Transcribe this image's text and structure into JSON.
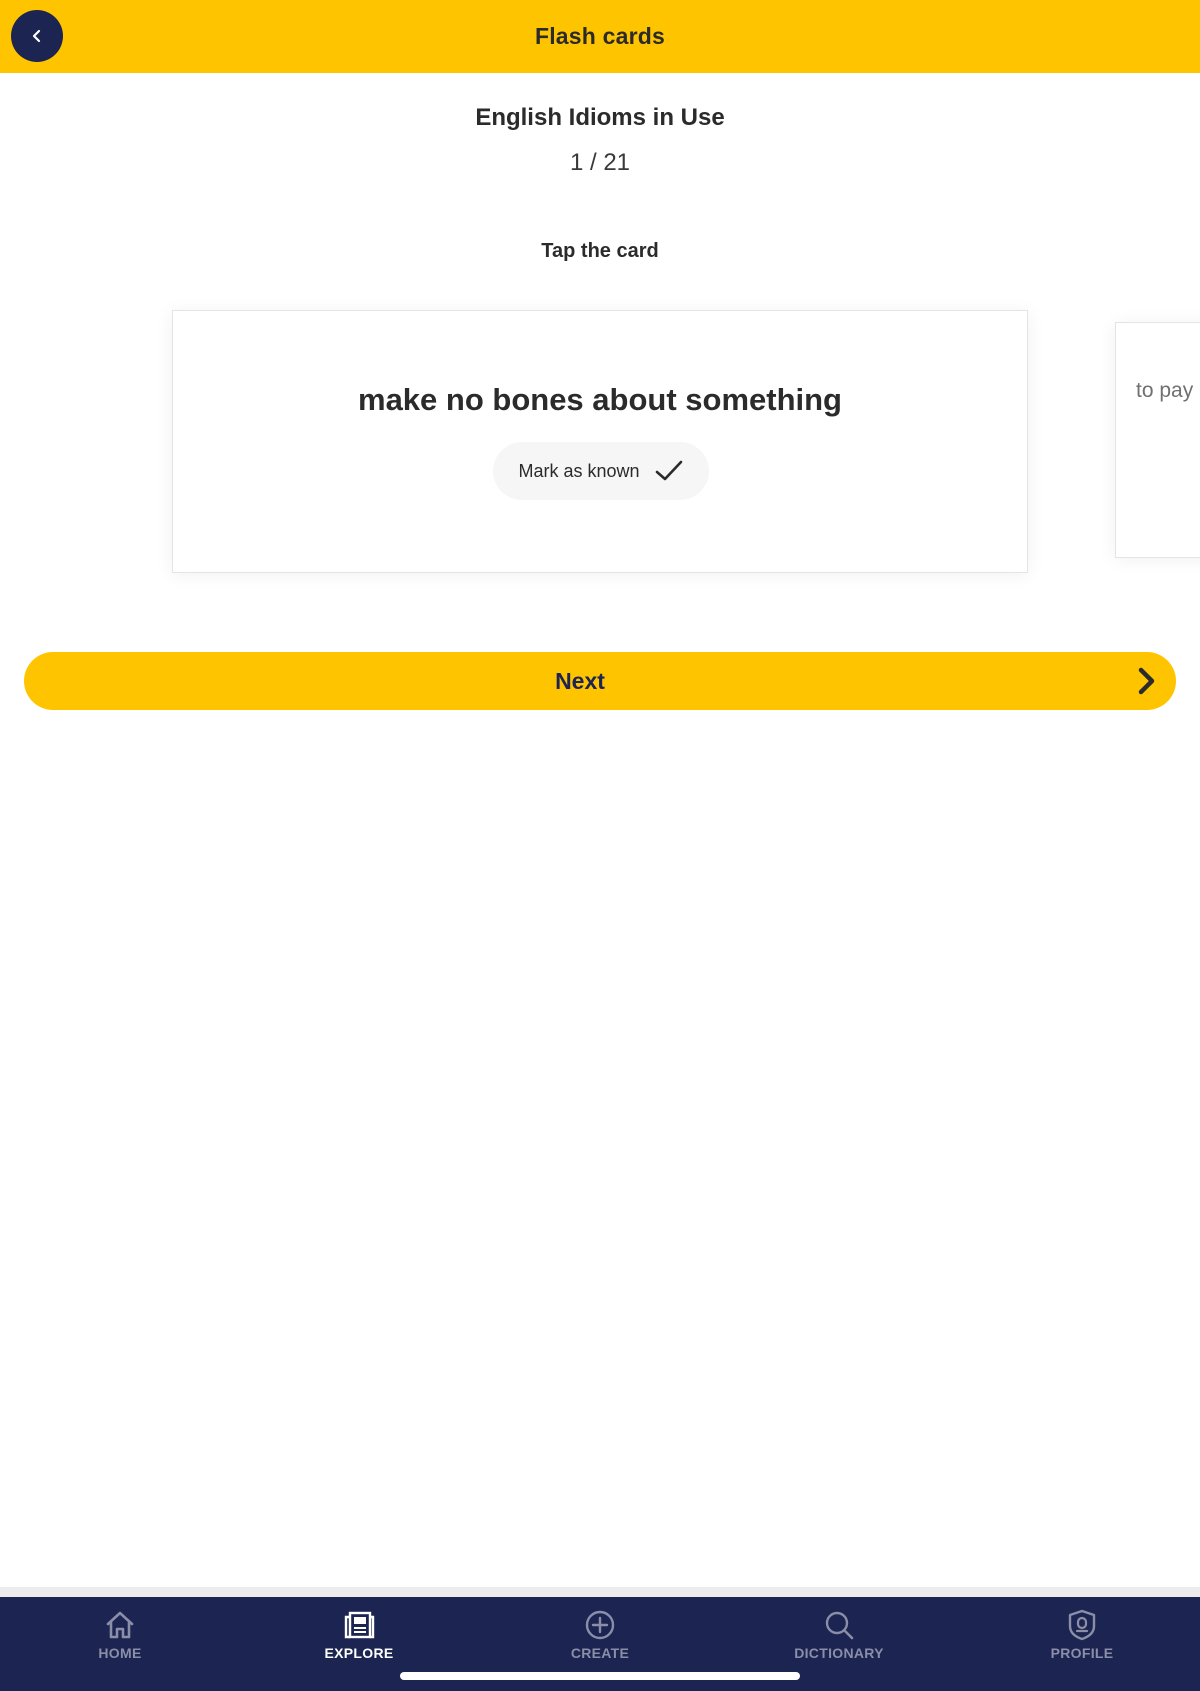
{
  "header": {
    "title": "Flash cards",
    "back_icon": "chevron-left-icon"
  },
  "deck": {
    "title": "English Idioms in Use",
    "progress": "1 / 21"
  },
  "instruction": "Tap the card",
  "card": {
    "term": "make no bones about something",
    "mark_known_label": "Mark as known",
    "mark_known_icon": "check-icon"
  },
  "next_card_peek": {
    "text": "to pay"
  },
  "next_button": {
    "label": "Next",
    "icon": "chevron-right-icon"
  },
  "nav": {
    "items": [
      {
        "label": "HOME",
        "icon": "home-icon",
        "active": false
      },
      {
        "label": "EXPLORE",
        "icon": "newspaper-icon",
        "active": true
      },
      {
        "label": "CREATE",
        "icon": "plus-circle-icon",
        "active": false
      },
      {
        "label": "DICTIONARY",
        "icon": "search-icon",
        "active": false
      },
      {
        "label": "PROFILE",
        "icon": "shield-icon",
        "active": false
      }
    ]
  },
  "colors": {
    "accent_yellow": "#ffc400",
    "navy": "#1c2452",
    "nav_inactive": "#8a8ea6",
    "text_dark": "#2b2b2b"
  }
}
